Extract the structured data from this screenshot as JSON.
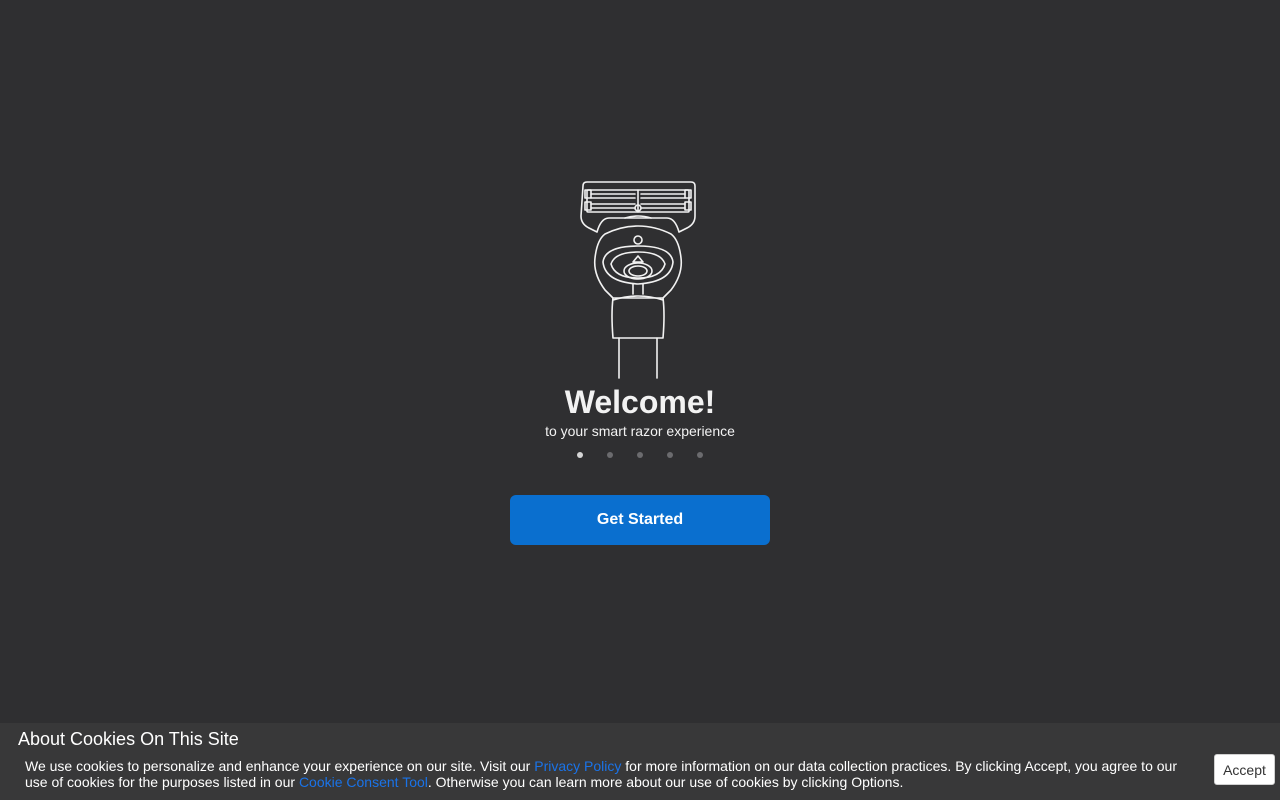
{
  "welcome": {
    "title": "Welcome!",
    "subtitle": "to your smart razor experience",
    "illustration_icon": "smart-razor-icon",
    "pager": {
      "count": 5,
      "active_index": 0
    },
    "cta_label": "Get Started"
  },
  "cookie_banner": {
    "title": "About Cookies On This Site",
    "text_part1": "We use cookies to personalize and enhance your experience on our site. Visit our ",
    "privacy_link": "Privacy Policy",
    "text_part2": " for more information on our data collection practices. By clicking Accept, you agree to our use of cookies for the purposes listed in our ",
    "consent_link": "Cookie Consent Tool",
    "text_part3": ". Otherwise you can learn more about our use of cookies by clicking Options.",
    "accept_label": "Accept"
  },
  "colors": {
    "background": "#2f2f31",
    "primary_button": "#0a6fcf",
    "link": "#1a73e8",
    "banner": "#383839"
  }
}
